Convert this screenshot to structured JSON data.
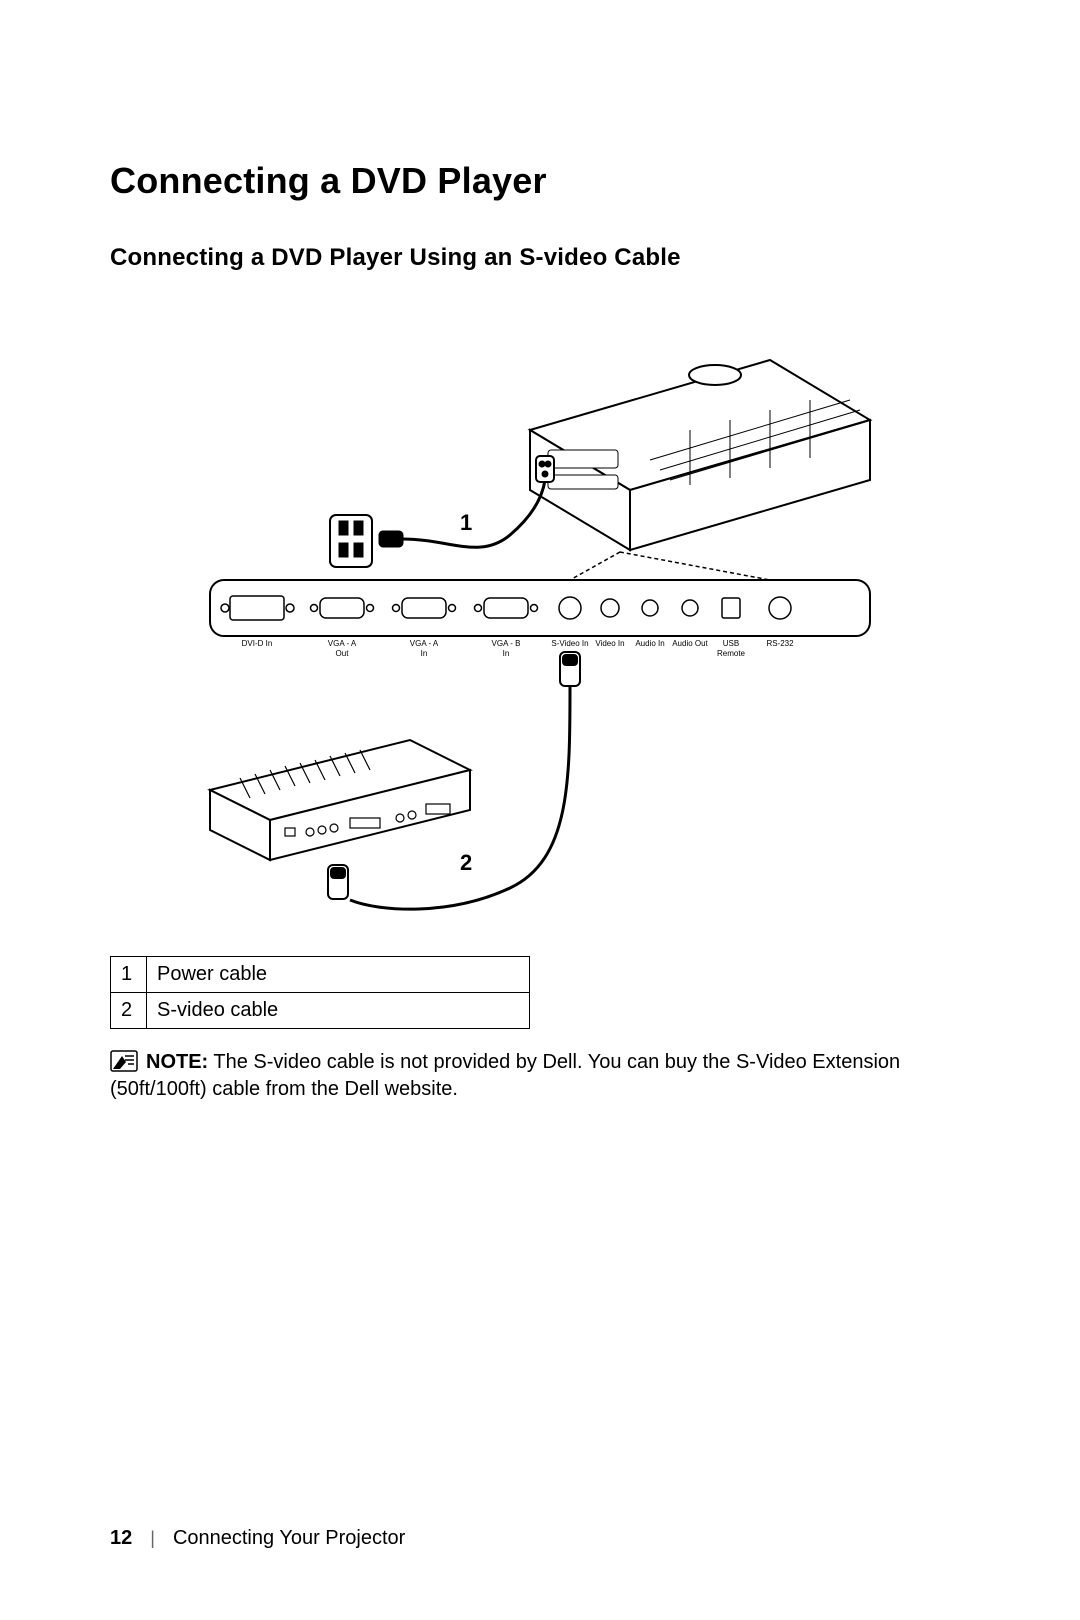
{
  "heading": "Connecting a DVD Player",
  "subheading": "Connecting a DVD Player Using an S-video Cable",
  "diagram": {
    "callouts": {
      "c1": "1",
      "c2": "2"
    },
    "ports": {
      "dvi": "DVI-D In",
      "vga_a_out": "VGA - A",
      "vga_a_out2": "Out",
      "vga_a_in": "VGA - A",
      "vga_a_in2": "In",
      "vga_b_in": "VGA - B",
      "vga_b_in2": "In",
      "svideo": "S-Video In",
      "video": "Video In",
      "audio_in": "Audio In",
      "audio_out": "Audio Out",
      "usb": "USB",
      "usb2": "Remote",
      "rs232": "RS-232"
    }
  },
  "legend": {
    "rows": [
      {
        "num": "1",
        "label": "Power cable"
      },
      {
        "num": "2",
        "label": "S-video cable"
      }
    ]
  },
  "note": {
    "label": "NOTE:",
    "text": " The S-video cable is not provided by Dell. You can buy the S-Video Extension (50ft/100ft) cable from the Dell website."
  },
  "footer": {
    "page": "12",
    "section": "Connecting Your Projector"
  }
}
